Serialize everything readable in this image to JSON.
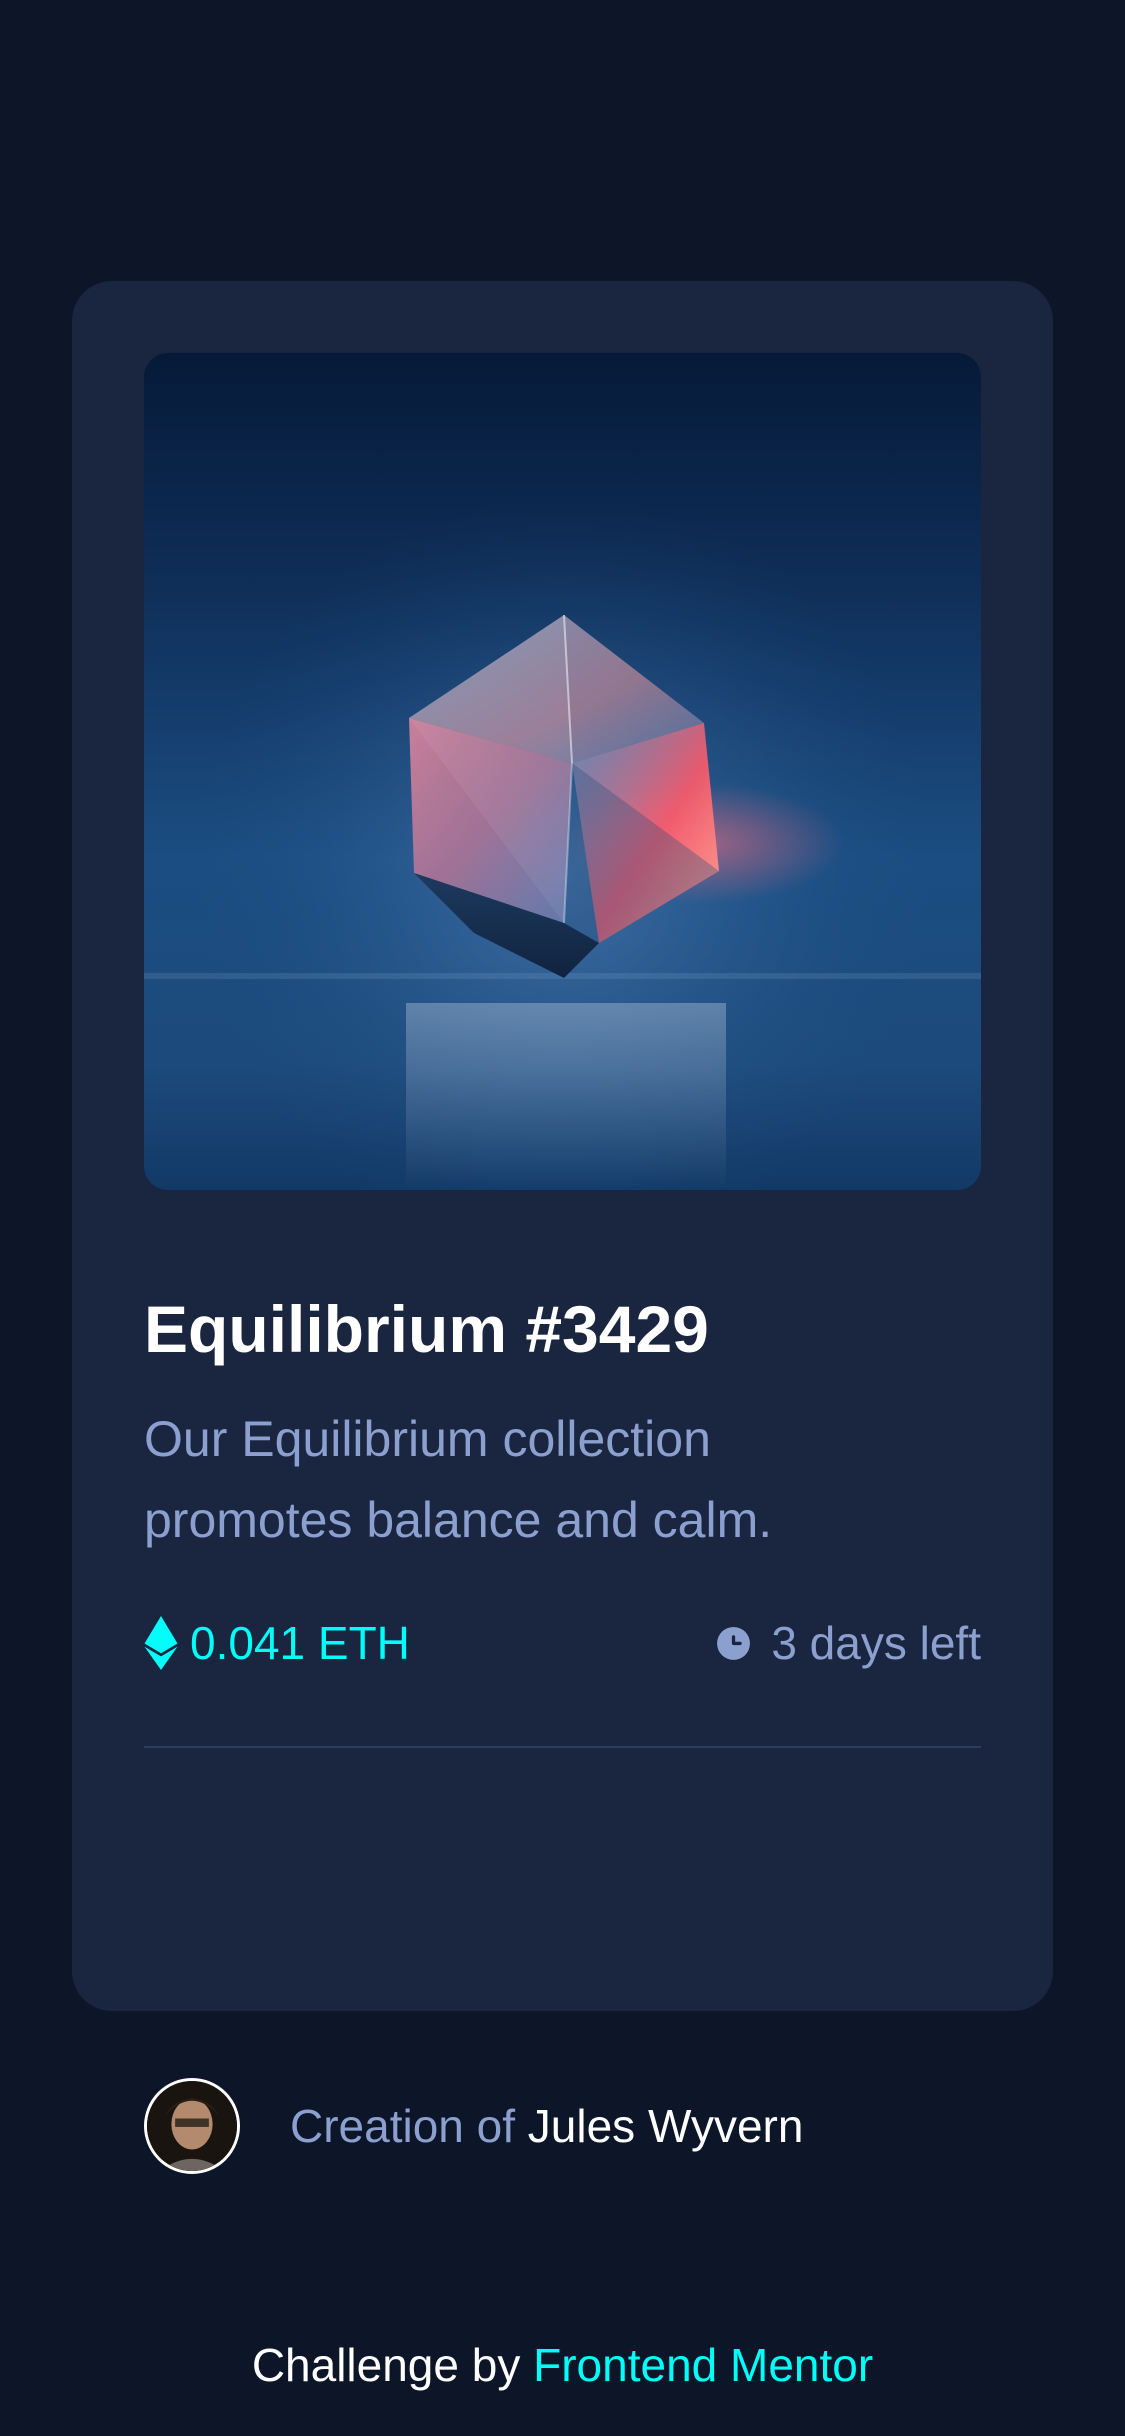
{
  "card": {
    "image_alt": "Equilibrium cube",
    "title": "Equilibrium #3429",
    "description": "Our Equilibrium collection promotes balance and calm.",
    "price": "0.041 ETH",
    "time_left": "3 days left",
    "creator_prefix": "Creation of",
    "creator_name": "Jules Wyvern"
  },
  "icons": {
    "ethereum": "ethereum-icon",
    "clock": "clock-icon"
  },
  "footer": {
    "challenge_prefix": "Challenge by",
    "challenge_link": "Frontend Mentor"
  },
  "colors": {
    "page_bg": "#0d1629",
    "card_bg": "#1a2540",
    "accent_cyan": "#00fff8",
    "soft_blue": "#8ba0cf",
    "white": "#ffffff"
  }
}
